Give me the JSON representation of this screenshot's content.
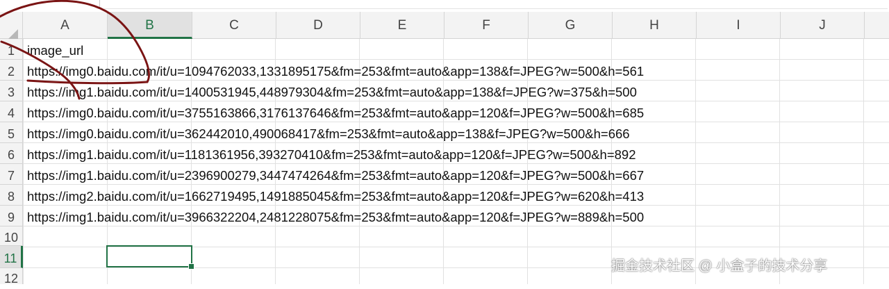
{
  "columns": [
    "A",
    "B",
    "C",
    "D",
    "E",
    "F",
    "G",
    "H",
    "I",
    "J"
  ],
  "rows": [
    "1",
    "2",
    "3",
    "4",
    "5",
    "6",
    "7",
    "8",
    "9",
    "10",
    "11",
    "12"
  ],
  "cells": {
    "A1": "image_url",
    "A2": "https://img0.baidu.com/it/u=1094762033,1331895175&fm=253&fmt=auto&app=138&f=JPEG?w=500&h=561",
    "A3": "https://img1.baidu.com/it/u=1400531945,448979304&fm=253&fmt=auto&app=138&f=JPEG?w=375&h=500",
    "A4": "https://img0.baidu.com/it/u=3755163866,3176137646&fm=253&fmt=auto&app=120&f=JPEG?w=500&h=685",
    "A5": "https://img0.baidu.com/it/u=362442010,490068417&fm=253&fmt=auto&app=138&f=JPEG?w=500&h=666",
    "A6": "https://img1.baidu.com/it/u=1181361956,393270410&fm=253&fmt=auto&app=120&f=JPEG?w=500&h=892",
    "A7": "https://img1.baidu.com/it/u=2396900279,3447474264&fm=253&fmt=auto&app=120&f=JPEG?w=500&h=667",
    "A8": "https://img2.baidu.com/it/u=1662719495,1491885045&fm=253&fmt=auto&app=120&f=JPEG?w=620&h=413",
    "A9": "https://img1.baidu.com/it/u=3966322204,2481228075&fm=253&fmt=auto&app=120&f=JPEG?w=889&h=500"
  },
  "selection": {
    "column": "B",
    "row": "11"
  },
  "watermark": "掘金技术社区 @ 小盒子的技术分享",
  "colors": {
    "accent": "#217346",
    "annotation": "#7a1414"
  }
}
